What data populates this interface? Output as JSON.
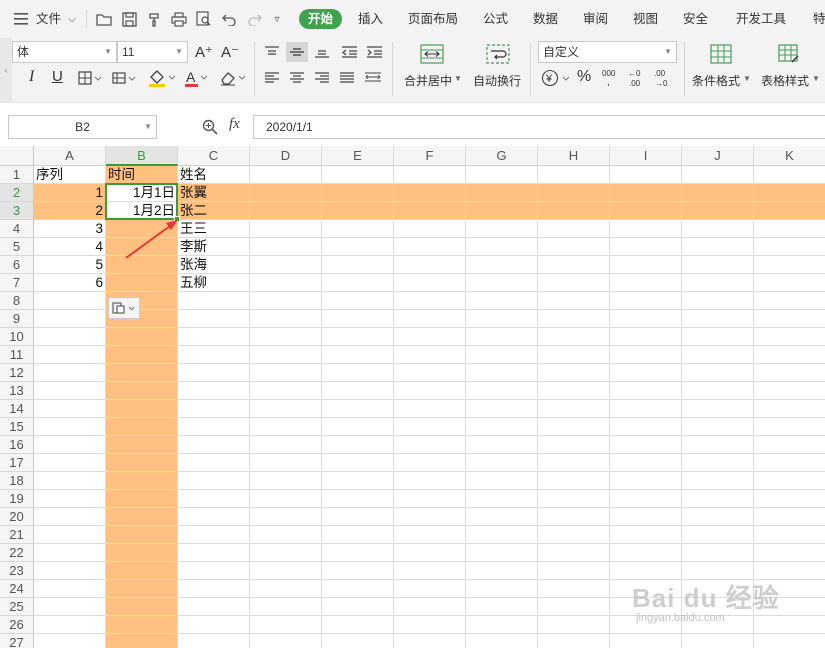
{
  "menu": {
    "file_label": "文件",
    "tabs": [
      "开始",
      "插入",
      "页面布局",
      "公式",
      "数据",
      "审阅",
      "视图",
      "安全",
      "开发工具",
      "特"
    ],
    "active_tab": "开始"
  },
  "ribbon": {
    "font_name": "体",
    "font_size": "11",
    "number_format": "自定义",
    "merge_center_label": "合并居中",
    "wrap_text_label": "自动换行",
    "conditional_format_label": "条件格式",
    "table_style_label": "表格样式",
    "currency_symbol": "¥",
    "percent_symbol": "%",
    "increase_font_glyph": "A⁺",
    "decrease_font_glyph": "A⁻",
    "italic_glyph": "I",
    "underline_glyph": "U",
    "font_color_glyph": "A",
    "expand_glyph": "‹"
  },
  "formula_bar": {
    "name_box": "B2",
    "fx_label": "fx",
    "content": "2020/1/1"
  },
  "sheet": {
    "columns": [
      "A",
      "B",
      "C",
      "D",
      "E",
      "F",
      "G",
      "H",
      "I",
      "J",
      "K"
    ],
    "rows": [
      "1",
      "2",
      "3",
      "4",
      "5",
      "6",
      "7",
      "8",
      "9",
      "10",
      "11",
      "12",
      "13",
      "14",
      "15",
      "16",
      "17",
      "18",
      "19",
      "20",
      "21",
      "22",
      "23",
      "24",
      "25",
      "26",
      "27"
    ],
    "highlighted_rows": [
      "2",
      "3"
    ],
    "highlighted_column": "B",
    "selected_range": "B2:B3",
    "cells": {
      "A1": "序列",
      "B1": "时间",
      "C1": "姓名",
      "A2": "1",
      "B2": "1月1日",
      "C2": "张翼",
      "A3": "2",
      "B3": "1月2日",
      "C3": "张二",
      "A4": "3",
      "C4": "王三",
      "A5": "4",
      "C5": "李斯",
      "A6": "5",
      "C6": "张海",
      "A7": "6",
      "C7": "五柳"
    }
  },
  "colors": {
    "highlight": "#ffc080",
    "selection_border": "#3c9a3c",
    "active_tab_bg": "#3fa34d",
    "annotation_arrow": "#e53935"
  },
  "watermark": {
    "brand": "Bai du 经验",
    "url": "jingyan.baidu.com"
  }
}
